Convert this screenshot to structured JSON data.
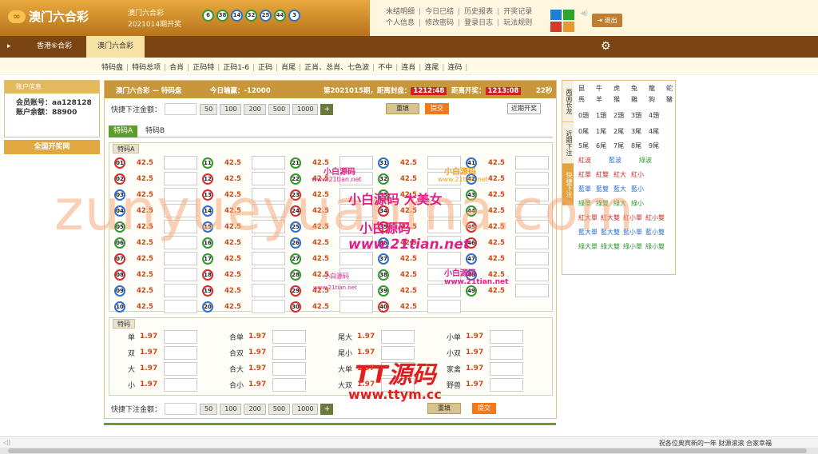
{
  "header": {
    "logo_mark": "∞",
    "logo_text": "澳门六合彩",
    "game_name": "澳门六合彩",
    "period": "2021014期开奖",
    "last_draw_balls": [
      "6",
      "38",
      "14",
      "32",
      "25",
      "44",
      "3"
    ],
    "links_row1": [
      "未结明细",
      "今日已结",
      "历史报表",
      "开奖记录"
    ],
    "links_row2": [
      "个人信息",
      "修改密码",
      "登录日志",
      "玩法规则"
    ],
    "logout": "退出",
    "logout_icon": "exit-icon",
    "colors": {
      "blue": "#1e7fd6",
      "green": "#2ea52e",
      "red": "#d33a2a",
      "orange": "#e79a2b"
    }
  },
  "nav1": {
    "items": [
      "香港⑥合彩",
      "澳门六合彩"
    ],
    "arrow": "▸",
    "gear_icon": "gear-icon",
    "gear_glyph": "⚙"
  },
  "nav2": {
    "items": [
      "特码盘",
      "特码总项",
      "合肖",
      "正码特",
      "正码1-6",
      "正码",
      "肖尾",
      "正肖、总肖、七色波",
      "不中",
      "连肖",
      "连尾",
      "连码"
    ]
  },
  "sidebar": {
    "title": "账户信息",
    "account_label": "会员账号：",
    "account": "aa128128",
    "balance_label": "账户余额：",
    "balance": "88900",
    "national_button": "全国开奖网"
  },
  "main": {
    "title": "澳门六合彩 — 特码盘",
    "today_label": "今日输赢：",
    "today_value": "-12000",
    "period_label": "第2021015期，距离封盘：",
    "close_time": "1212:48",
    "open_label": "距离开奖：",
    "open_time": "1213:08",
    "refresh": "22秒",
    "quick_label": "快捷下注金额：",
    "quick_amounts": [
      "50",
      "100",
      "200",
      "500",
      "1000"
    ],
    "plus": "+",
    "reset": "重填",
    "submit": "提交",
    "recent": "近期开奖",
    "tabs": [
      "特码A",
      "特码B"
    ],
    "panel_a_title": "特码A",
    "odds": "42.5",
    "panel_b_title": "特码",
    "extra_bets": [
      [
        {
          "n": "单",
          "o": "1.97"
        },
        {
          "n": "合单",
          "o": "1.97"
        },
        {
          "n": "尾大",
          "o": "1.97"
        },
        {
          "n": "小单",
          "o": "1.97"
        }
      ],
      [
        {
          "n": "双",
          "o": "1.97"
        },
        {
          "n": "合双",
          "o": "1.97"
        },
        {
          "n": "尾小",
          "o": "1.97"
        },
        {
          "n": "小双",
          "o": "1.97"
        }
      ],
      [
        {
          "n": "大",
          "o": "1.97"
        },
        {
          "n": "合大",
          "o": "1.97"
        },
        {
          "n": "大单",
          "o": "1.97"
        },
        {
          "n": "家禽",
          "o": "1.97"
        }
      ],
      [
        {
          "n": "小",
          "o": "1.97"
        },
        {
          "n": "合小",
          "o": "1.97"
        },
        {
          "n": "大双",
          "o": "1.97"
        },
        {
          "n": "野兽",
          "o": "1.97"
        }
      ]
    ]
  },
  "right_panel": {
    "tabs": [
      "两面长龙",
      "近期下注",
      "快捷下注"
    ],
    "zodiac_row1": [
      "鼠",
      "牛",
      "虎",
      "兔",
      "龍",
      "蛇"
    ],
    "zodiac_row2": [
      "馬",
      "羊",
      "猴",
      "雞",
      "狗",
      "豬"
    ],
    "head_row": [
      "0頭",
      "1頭",
      "2頭",
      "3頭",
      "4頭"
    ],
    "tail_row1": [
      "0尾",
      "1尾",
      "2尾",
      "3尾",
      "4尾"
    ],
    "tail_row2": [
      "5尾",
      "6尾",
      "7尾",
      "8尾",
      "9尾"
    ],
    "wave_row": [
      "紅波",
      "藍波",
      "綠波"
    ],
    "red_row": [
      "紅單",
      "紅雙",
      "紅大",
      "紅小"
    ],
    "blue_row": [
      "藍單",
      "藍雙",
      "藍大",
      "藍小"
    ],
    "green_row": [
      "綠單",
      "綠雙",
      "綠大",
      "綠小"
    ],
    "red_half": [
      "紅大單",
      "紅大雙",
      "紅小單",
      "紅小雙"
    ],
    "blue_half": [
      "藍大單",
      "藍大雙",
      "藍小單",
      "藍小雙"
    ],
    "green_half": [
      "綠大單",
      "綠大雙",
      "綠小單",
      "綠小雙"
    ]
  },
  "watermarks": {
    "big": "zunyueyuanma.com",
    "w1": "小白源码",
    "w2": "www.21tian.net",
    "w3": "小白源码",
    "w4": "www.21tian.net",
    "w5": "小白源码 大美女",
    "w6": "小白源码",
    "w7": "www.21tian.net",
    "w8": "小白源码",
    "w9": "www.21tian.net",
    "w10": "小白源码",
    "w11": "www.21tian.net",
    "w12": "TT源码",
    "w13": "www.ttym.cc"
  },
  "footer": {
    "text": "祝各位奥宾新的一年 财源滚滚 合家幸福",
    "speaker": "◁)"
  }
}
